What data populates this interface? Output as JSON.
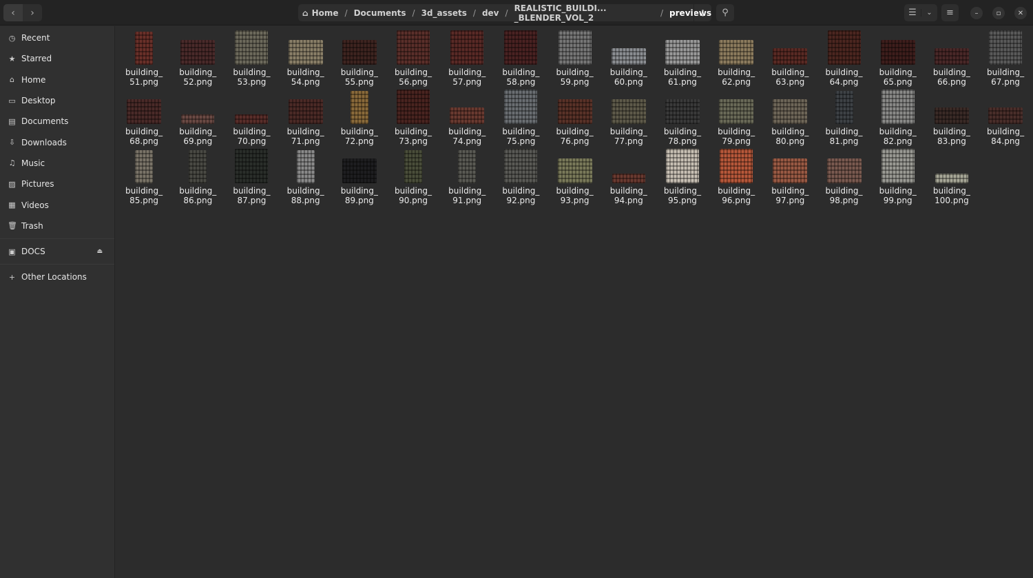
{
  "header": {
    "breadcrumb": [
      "Home",
      "Documents",
      "3d_assets",
      "dev",
      "REALISTIC_BUILDI... _BLENDER_VOL_2"
    ],
    "current": "previews"
  },
  "sidebar": {
    "items": [
      {
        "label": "Recent",
        "icon": "clock-icon"
      },
      {
        "label": "Starred",
        "icon": "star-icon"
      },
      {
        "label": "Home",
        "icon": "home-icon"
      },
      {
        "label": "Desktop",
        "icon": "desktop-icon"
      },
      {
        "label": "Documents",
        "icon": "documents-icon"
      },
      {
        "label": "Downloads",
        "icon": "download-icon"
      },
      {
        "label": "Music",
        "icon": "music-icon"
      },
      {
        "label": "Pictures",
        "icon": "pictures-icon"
      },
      {
        "label": "Videos",
        "icon": "videos-icon"
      },
      {
        "label": "Trash",
        "icon": "trash-icon"
      }
    ],
    "drive": "DOCS",
    "other": "Other Locations"
  },
  "files": [
    {
      "name": "building_51.png",
      "color": "#6a3029",
      "shape": "tall"
    },
    {
      "name": "building_52.png",
      "color": "#4a2a2a",
      "shape": "wide"
    },
    {
      "name": "building_53.png",
      "color": "#6d6a5c",
      "shape": "big"
    },
    {
      "name": "building_54.png",
      "color": "#8a7f68",
      "shape": "wide"
    },
    {
      "name": "building_55.png",
      "color": "#3e2420",
      "shape": "wide"
    },
    {
      "name": "building_56.png",
      "color": "#5b2f2a",
      "shape": "big"
    },
    {
      "name": "building_57.png",
      "color": "#5a2a26",
      "shape": "big"
    },
    {
      "name": "building_58.png",
      "color": "#4a2222",
      "shape": "big"
    },
    {
      "name": "building_59.png",
      "color": "#777",
      "shape": "big"
    },
    {
      "name": "building_60.png",
      "color": "#8b8e92",
      "shape": "low"
    },
    {
      "name": "building_61.png",
      "color": "#9a9a9a",
      "shape": "wide"
    },
    {
      "name": "building_62.png",
      "color": "#8d7c5e",
      "shape": "wide"
    },
    {
      "name": "building_63.png",
      "color": "#5a2a24",
      "shape": "low"
    },
    {
      "name": "building_64.png",
      "color": "#4c2620",
      "shape": "big"
    },
    {
      "name": "building_65.png",
      "color": "#3e1e1c",
      "shape": "wide"
    },
    {
      "name": "building_66.png",
      "color": "#4a2828",
      "shape": "low"
    },
    {
      "name": "building_67.png",
      "color": "#5a5a5a",
      "shape": "big"
    },
    {
      "name": "building_68.png",
      "color": "#4a2a28",
      "shape": "wide"
    },
    {
      "name": "building_69.png",
      "color": "#6a4a44",
      "shape": "flat"
    },
    {
      "name": "building_70.png",
      "color": "#5a2e2a",
      "shape": "flat"
    },
    {
      "name": "building_71.png",
      "color": "#4c2a26",
      "shape": "wide"
    },
    {
      "name": "building_72.png",
      "color": "#8a6a3a",
      "shape": "tall"
    },
    {
      "name": "building_73.png",
      "color": "#4a2420",
      "shape": "big"
    },
    {
      "name": "building_74.png",
      "color": "#6a3a30",
      "shape": "low"
    },
    {
      "name": "building_75.png",
      "color": "#6a6e72",
      "shape": "big"
    },
    {
      "name": "building_76.png",
      "color": "#5a3228",
      "shape": "wide"
    },
    {
      "name": "building_77.png",
      "color": "#5e5a4a",
      "shape": "wide"
    },
    {
      "name": "building_78.png",
      "color": "#3a3a3a",
      "shape": "wide"
    },
    {
      "name": "building_79.png",
      "color": "#6a6a58",
      "shape": "wide"
    },
    {
      "name": "building_80.png",
      "color": "#6e6658",
      "shape": "wide"
    },
    {
      "name": "building_81.png",
      "color": "#3e4246",
      "shape": "tall"
    },
    {
      "name": "building_82.png",
      "color": "#8a8a88",
      "shape": "big"
    },
    {
      "name": "building_83.png",
      "color": "#3a2a26",
      "shape": "low"
    },
    {
      "name": "building_84.png",
      "color": "#4a2e2a",
      "shape": "low"
    },
    {
      "name": "building_85.png",
      "color": "#7a7468",
      "shape": "tall"
    },
    {
      "name": "building_86.png",
      "color": "#4a4a44",
      "shape": "tall"
    },
    {
      "name": "building_87.png",
      "color": "#2a2e2a",
      "shape": "big"
    },
    {
      "name": "building_88.png",
      "color": "#8a8a8a",
      "shape": "tall"
    },
    {
      "name": "building_89.png",
      "color": "#1e1e20",
      "shape": "wide"
    },
    {
      "name": "building_90.png",
      "color": "#4a4e3a",
      "shape": "tall"
    },
    {
      "name": "building_91.png",
      "color": "#5a5a54",
      "shape": "tall"
    },
    {
      "name": "building_92.png",
      "color": "#5a5a56",
      "shape": "big"
    },
    {
      "name": "building_93.png",
      "color": "#7a7a5a",
      "shape": "wide"
    },
    {
      "name": "building_94.png",
      "color": "#6a3a30",
      "shape": "flat"
    },
    {
      "name": "building_95.png",
      "color": "#c8c0b4",
      "shape": "big"
    },
    {
      "name": "building_96.png",
      "color": "#b8583a",
      "shape": "big"
    },
    {
      "name": "building_97.png",
      "color": "#9a5a44",
      "shape": "wide"
    },
    {
      "name": "building_98.png",
      "color": "#7a5a50",
      "shape": "wide"
    },
    {
      "name": "building_99.png",
      "color": "#9a9a94",
      "shape": "big"
    },
    {
      "name": "building_100.png",
      "color": "#a8a898",
      "shape": "flat"
    }
  ]
}
